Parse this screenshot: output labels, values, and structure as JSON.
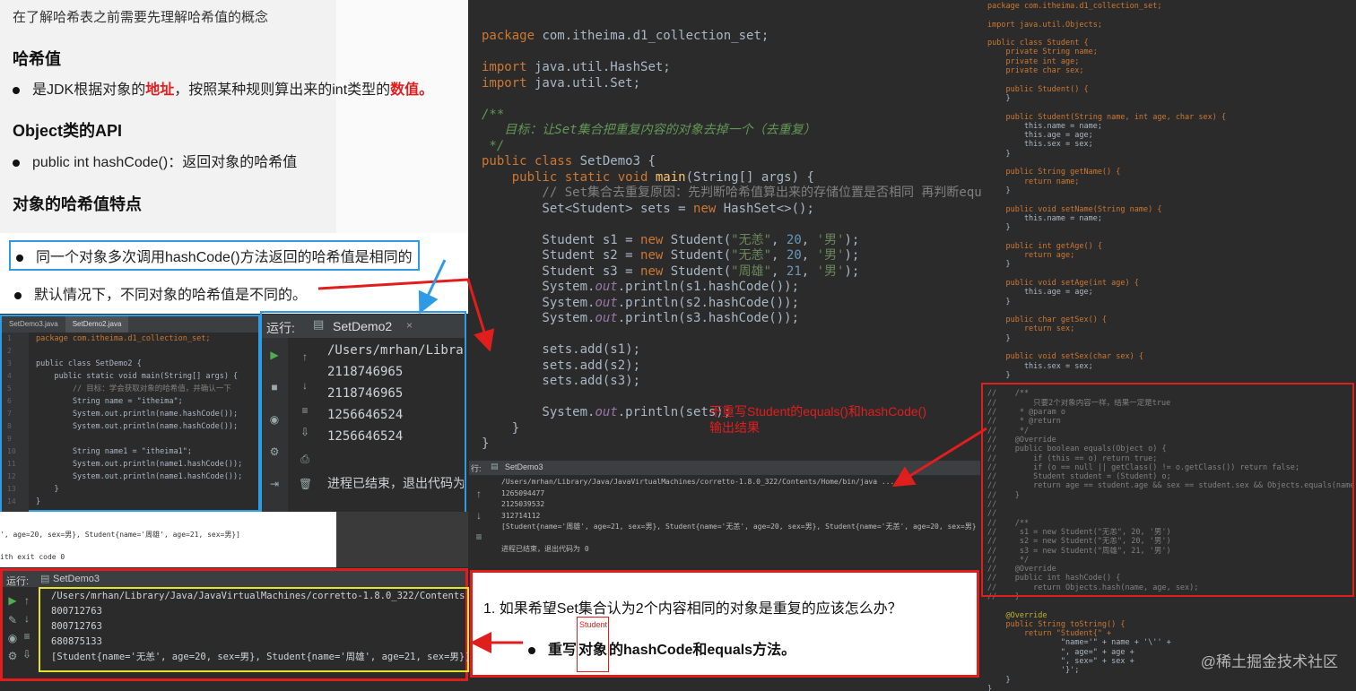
{
  "slide": {
    "top_note": "在了解哈希表之前需要先理解哈希值的概念",
    "section1": "哈希值",
    "def_prefix": "是JDK根据对象的",
    "def_addr": "地址",
    "def_mid": "，按照某种规则算出来的int类型的",
    "def_val": "数值。",
    "section2": "Object类的API",
    "api": "public int hashCode()：返回对象的哈希值",
    "section3": "对象的哈希值特点",
    "feat1": "同一个对象多次调用hashCode()方法返回的哈希值是相同的",
    "feat2": "默认情况下，不同对象的哈希值是不同的。"
  },
  "editor1": {
    "tabs": [
      "SetDemo3.java",
      "SetDemo2.java"
    ],
    "lines": [
      "package com.itheima.d1_collection_set;",
      "",
      "public class SetDemo2 {",
      "    public static void main(String[] args) {",
      "        // 目标：学会获取对象的哈希值，并确认一下",
      "        String name = \"itheima\";",
      "        System.out.println(name.hashCode());",
      "        System.out.println(name.hashCode());",
      "",
      "        String name1 = \"itheima1\";",
      "        System.out.println(name1.hashCode());",
      "        System.out.println(name1.hashCode());",
      "    }",
      "}"
    ],
    "gutter": [
      "1",
      "2",
      "3",
      "4",
      "5",
      "6",
      "7",
      "8",
      "9",
      "10",
      "11",
      "12",
      "13",
      "14"
    ]
  },
  "run1": {
    "label": "运行:",
    "tab": "SetDemo2",
    "path": "/Users/mrhan/Libra",
    "outputs": [
      "2118746965",
      "2118746965",
      "1256646524",
      "1256646524"
    ],
    "finished": "进程已结束，退出代码为"
  },
  "midstrip": {
    "line1": "', age=20, sex=男}, Student{name='周雄', age=21, sex=男}]",
    "line2": "ith exit code 0"
  },
  "run2": {
    "label": "运行:",
    "tab": "SetDemo3",
    "path": "/Users/mrhan/Library/Java/JavaVirtualMachines/corretto-1.8.0_322/Contents/Home",
    "outputs": [
      "800712763",
      "800712763",
      "680875133",
      "[Student{name='无恙', age=20, sex=男}, Student{name='周雄', age=21, sex=男}]"
    ]
  },
  "editor2": {
    "annotation_line1": "不重写Student的equals()和hashCode()",
    "annotation_line2": "输出结果"
  },
  "run3": {
    "tab": "SetDemo3",
    "path": "/Users/mrhan/Library/Java/JavaVirtualMachines/corretto-1.8.0_322/Contents/Home/bin/java ...",
    "outputs": [
      "1265094477",
      "2125039532",
      "312714112",
      "[Student{name='周雄', age=21, sex=男}, Student{name='无恙', age=20, sex=男}, Student{name='无恙', age=20, sex=男}]",
      "",
      "进程已结束，退出代码为 0"
    ]
  },
  "question": {
    "q": "1.  如果希望Set集合认为2个内容相同的对象是重复的应该怎么办？",
    "a_prefix": "重写",
    "a_box_label": "Student",
    "a_box": "对象",
    "a_suffix": "的hashCode和equals方法。"
  },
  "editor3": {
    "lines": [
      "package com.itheima.d1_collection_set;",
      "",
      "import java.util.Objects;",
      "",
      "public class Student {",
      "    private String name;",
      "    private int age;",
      "    private char sex;",
      "",
      "    public Student() {",
      "    }",
      "",
      "    public Student(String name, int age, char sex) {",
      "        this.name = name;",
      "        this.age = age;",
      "        this.sex = sex;",
      "    }",
      "",
      "    public String getName() {",
      "        return name;",
      "    }",
      "",
      "    public void setName(String name) {",
      "        this.name = name;",
      "    }",
      "",
      "    public int getAge() {",
      "        return age;",
      "    }",
      "",
      "    public void setAge(int age) {",
      "        this.age = age;",
      "    }",
      "",
      "    public char getSex() {",
      "        return sex;",
      "    }",
      "",
      "    public void setSex(char sex) {",
      "        this.sex = sex;",
      "    }",
      "",
      "//    /**",
      "//        只要2个对象内容一样，结果一定是true",
      "//     * @param o",
      "//     * @return",
      "//     */",
      "//    @Override",
      "//    public boolean equals(Object o) {",
      "//        if (this == o) return true;",
      "//        if (o == null || getClass() != o.getClass()) return false;",
      "//        Student student = (Student) o;",
      "//        return age == student.age && sex == student.sex && Objects.equals(name, student.name);",
      "//    }",
      "//",
      "//",
      "//    /**",
      "//     s1 = new Student(\"无恙\", 20, '男')",
      "//     s2 = new Student(\"无恙\", 20, '男')",
      "//     s3 = new Student(\"周雄\", 21, '男')",
      "//     */",
      "//    @Override",
      "//    public int hashCode() {",
      "//        return Objects.hash(name, age, sex);",
      "//    }",
      "",
      "    @Override",
      "    public String toString() {",
      "        return \"Student{\" +",
      "                \"name='\" + name + '\\'' +",
      "                \", age=\" + age +",
      "                \", sex=\" + sex +",
      "                '}';",
      "    }",
      "}"
    ]
  },
  "watermark": "@稀土掘金技术社区"
}
